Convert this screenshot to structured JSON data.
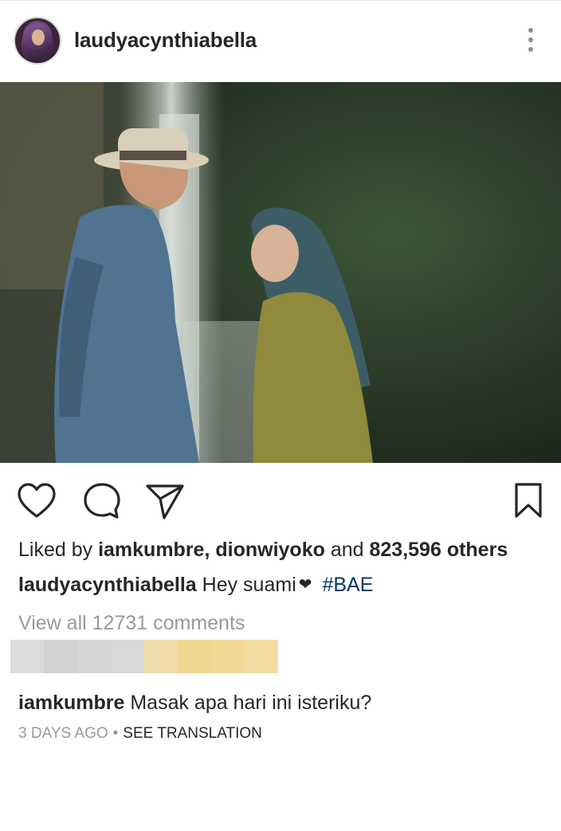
{
  "post": {
    "username": "laudyacynthiabella",
    "likes": {
      "prefix": "Liked by",
      "user1": "iamkumbre",
      "separator": ",",
      "user2": "dionwiyoko",
      "and": "and",
      "count": "823,596 others"
    },
    "caption": {
      "username": "laudyacynthiabella",
      "text": "Hey suami",
      "emoji": "❤",
      "hashtag": "#BAE"
    },
    "view_all_comments": "View all 12731 comments",
    "comment": {
      "username": "iamkumbre",
      "text": "Masak apa hari ini isteriku?"
    },
    "timestamp": "3 DAYS AGO",
    "meta_separator": "•",
    "see_translation": "SEE TRANSLATION"
  },
  "icons": {
    "menu": "more-vertical-icon",
    "like": "heart-icon",
    "comment": "comment-icon",
    "share": "paper-plane-icon",
    "save": "bookmark-icon"
  },
  "colors": {
    "text": "#262626",
    "secondary": "#999999",
    "hashtag": "#003569"
  }
}
